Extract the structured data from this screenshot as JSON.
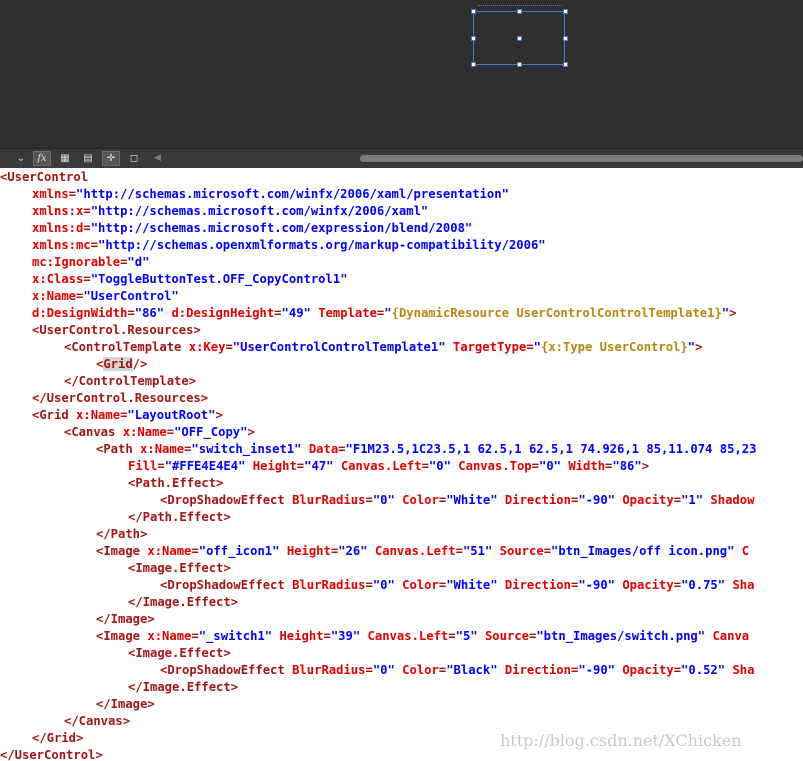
{
  "artboard": {
    "label": "design surface"
  },
  "toolbar": {
    "buttons": [
      {
        "name": "collapse",
        "glyph": "⌄"
      },
      {
        "name": "fx",
        "glyph": "fx"
      },
      {
        "name": "grid",
        "glyph": "▦"
      },
      {
        "name": "table",
        "glyph": "▤"
      },
      {
        "name": "snap",
        "glyph": "✛"
      },
      {
        "name": "annotation",
        "glyph": "◻"
      }
    ],
    "scroll_left": "◀"
  },
  "code": {
    "lines": [
      {
        "indent": 0,
        "tokens": [
          {
            "t": "<UserControl",
            "c": "t"
          }
        ]
      },
      {
        "indent": 1,
        "tokens": [
          {
            "t": "xmlns",
            "c": "a"
          },
          {
            "t": "=",
            "c": "t"
          },
          {
            "t": "\"http://schemas.microsoft.com/winfx/2006/xaml/presentation\"",
            "c": "v"
          }
        ]
      },
      {
        "indent": 1,
        "tokens": [
          {
            "t": "xmlns:x",
            "c": "a"
          },
          {
            "t": "=",
            "c": "t"
          },
          {
            "t": "\"http://schemas.microsoft.com/winfx/2006/xaml\"",
            "c": "v"
          }
        ]
      },
      {
        "indent": 1,
        "tokens": [
          {
            "t": "xmlns:d",
            "c": "a"
          },
          {
            "t": "=",
            "c": "t"
          },
          {
            "t": "\"http://schemas.microsoft.com/expression/blend/2008\"",
            "c": "v"
          }
        ]
      },
      {
        "indent": 1,
        "tokens": [
          {
            "t": "xmlns:mc",
            "c": "a"
          },
          {
            "t": "=",
            "c": "t"
          },
          {
            "t": "\"http://schemas.openxmlformats.org/markup-compatibility/2006\"",
            "c": "v"
          }
        ]
      },
      {
        "indent": 1,
        "tokens": [
          {
            "t": "mc:Ignorable",
            "c": "a"
          },
          {
            "t": "=",
            "c": "t"
          },
          {
            "t": "\"d\"",
            "c": "v"
          }
        ]
      },
      {
        "indent": 1,
        "tokens": [
          {
            "t": "x:Class",
            "c": "a"
          },
          {
            "t": "=",
            "c": "t"
          },
          {
            "t": "\"ToggleButtonTest.OFF_CopyControl1\"",
            "c": "v"
          }
        ]
      },
      {
        "indent": 1,
        "tokens": [
          {
            "t": "x:Name",
            "c": "a"
          },
          {
            "t": "=",
            "c": "t"
          },
          {
            "t": "\"UserControl\"",
            "c": "v"
          }
        ]
      },
      {
        "indent": 1,
        "tokens": [
          {
            "t": "d:DesignWidth",
            "c": "a"
          },
          {
            "t": "=",
            "c": "t"
          },
          {
            "t": "\"86\"",
            "c": "v"
          },
          {
            "t": " ",
            "c": "t"
          },
          {
            "t": "d:DesignHeight",
            "c": "a"
          },
          {
            "t": "=",
            "c": "t"
          },
          {
            "t": "\"49\"",
            "c": "v"
          },
          {
            "t": " ",
            "c": "t"
          },
          {
            "t": "Template",
            "c": "a"
          },
          {
            "t": "=",
            "c": "t"
          },
          {
            "t": "\"",
            "c": "v"
          },
          {
            "t": "{DynamicResource UserControlControlTemplate1}",
            "c": "b"
          },
          {
            "t": "\"",
            "c": "v"
          },
          {
            "t": ">",
            "c": "t"
          }
        ]
      },
      {
        "indent": 1,
        "tokens": [
          {
            "t": "<UserControl.Resources>",
            "c": "t"
          }
        ]
      },
      {
        "indent": 2,
        "tokens": [
          {
            "t": "<ControlTemplate",
            "c": "t"
          },
          {
            "t": " ",
            "c": "t"
          },
          {
            "t": "x:Key",
            "c": "a"
          },
          {
            "t": "=",
            "c": "t"
          },
          {
            "t": "\"UserControlControlTemplate1\"",
            "c": "v"
          },
          {
            "t": " ",
            "c": "t"
          },
          {
            "t": "TargetType",
            "c": "a"
          },
          {
            "t": "=",
            "c": "t"
          },
          {
            "t": "\"",
            "c": "v"
          },
          {
            "t": "{x:Type UserControl}",
            "c": "b"
          },
          {
            "t": "\"",
            "c": "v"
          },
          {
            "t": ">",
            "c": "t"
          }
        ]
      },
      {
        "indent": 3,
        "tokens": [
          {
            "t": "<",
            "c": "t"
          },
          {
            "t": "Grid",
            "c": "h"
          },
          {
            "t": "/>",
            "c": "t"
          }
        ]
      },
      {
        "indent": 2,
        "tokens": [
          {
            "t": "</ControlTemplate>",
            "c": "t"
          }
        ]
      },
      {
        "indent": 1,
        "tokens": [
          {
            "t": "</UserControl.Resources>",
            "c": "t"
          }
        ]
      },
      {
        "indent": 1,
        "tokens": [
          {
            "t": "<Grid",
            "c": "t"
          },
          {
            "t": " ",
            "c": "t"
          },
          {
            "t": "x:Name",
            "c": "a"
          },
          {
            "t": "=",
            "c": "t"
          },
          {
            "t": "\"LayoutRoot\"",
            "c": "v"
          },
          {
            "t": ">",
            "c": "t"
          }
        ]
      },
      {
        "indent": 2,
        "tokens": [
          {
            "t": "<Canvas",
            "c": "t"
          },
          {
            "t": " ",
            "c": "t"
          },
          {
            "t": "x:Name",
            "c": "a"
          },
          {
            "t": "=",
            "c": "t"
          },
          {
            "t": "\"OFF_Copy\"",
            "c": "v"
          },
          {
            "t": ">",
            "c": "t"
          }
        ]
      },
      {
        "indent": 3,
        "tokens": [
          {
            "t": "<Path",
            "c": "t"
          },
          {
            "t": " ",
            "c": "t"
          },
          {
            "t": "x:Name",
            "c": "a"
          },
          {
            "t": "=",
            "c": "t"
          },
          {
            "t": "\"switch_inset1\"",
            "c": "v"
          },
          {
            "t": " ",
            "c": "t"
          },
          {
            "t": "Data",
            "c": "a"
          },
          {
            "t": "=",
            "c": "t"
          },
          {
            "t": "\"F1M23.5,1C23.5,1 62.5,1 62.5,1 74.926,1 85,11.074 85,23",
            "c": "v"
          }
        ]
      },
      {
        "indent": 4,
        "tokens": [
          {
            "t": "Fill",
            "c": "a"
          },
          {
            "t": "=",
            "c": "t"
          },
          {
            "t": "\"#FFE4E4E4\"",
            "c": "v"
          },
          {
            "t": " ",
            "c": "t"
          },
          {
            "t": "Height",
            "c": "a"
          },
          {
            "t": "=",
            "c": "t"
          },
          {
            "t": "\"47\"",
            "c": "v"
          },
          {
            "t": " ",
            "c": "t"
          },
          {
            "t": "Canvas.Left",
            "c": "a"
          },
          {
            "t": "=",
            "c": "t"
          },
          {
            "t": "\"0\"",
            "c": "v"
          },
          {
            "t": " ",
            "c": "t"
          },
          {
            "t": "Canvas.Top",
            "c": "a"
          },
          {
            "t": "=",
            "c": "t"
          },
          {
            "t": "\"0\"",
            "c": "v"
          },
          {
            "t": " ",
            "c": "t"
          },
          {
            "t": "Width",
            "c": "a"
          },
          {
            "t": "=",
            "c": "t"
          },
          {
            "t": "\"86\"",
            "c": "v"
          },
          {
            "t": ">",
            "c": "t"
          }
        ]
      },
      {
        "indent": 4,
        "tokens": [
          {
            "t": "<Path.Effect>",
            "c": "t"
          }
        ]
      },
      {
        "indent": 5,
        "tokens": [
          {
            "t": "<DropShadowEffect",
            "c": "t"
          },
          {
            "t": " ",
            "c": "t"
          },
          {
            "t": "BlurRadius",
            "c": "a"
          },
          {
            "t": "=",
            "c": "t"
          },
          {
            "t": "\"0\"",
            "c": "v"
          },
          {
            "t": " ",
            "c": "t"
          },
          {
            "t": "Color",
            "c": "a"
          },
          {
            "t": "=",
            "c": "t"
          },
          {
            "t": "\"White\"",
            "c": "v"
          },
          {
            "t": " ",
            "c": "t"
          },
          {
            "t": "Direction",
            "c": "a"
          },
          {
            "t": "=",
            "c": "t"
          },
          {
            "t": "\"-90\"",
            "c": "v"
          },
          {
            "t": " ",
            "c": "t"
          },
          {
            "t": "Opacity",
            "c": "a"
          },
          {
            "t": "=",
            "c": "t"
          },
          {
            "t": "\"1\"",
            "c": "v"
          },
          {
            "t": " ",
            "c": "t"
          },
          {
            "t": "Shadow",
            "c": "a"
          }
        ]
      },
      {
        "indent": 4,
        "tokens": [
          {
            "t": "</Path.Effect>",
            "c": "t"
          }
        ]
      },
      {
        "indent": 3,
        "tokens": [
          {
            "t": "</Path>",
            "c": "t"
          }
        ]
      },
      {
        "indent": 3,
        "tokens": [
          {
            "t": "<Image",
            "c": "t"
          },
          {
            "t": " ",
            "c": "t"
          },
          {
            "t": "x:Name",
            "c": "a"
          },
          {
            "t": "=",
            "c": "t"
          },
          {
            "t": "\"off_icon1\"",
            "c": "v"
          },
          {
            "t": " ",
            "c": "t"
          },
          {
            "t": "Height",
            "c": "a"
          },
          {
            "t": "=",
            "c": "t"
          },
          {
            "t": "\"26\"",
            "c": "v"
          },
          {
            "t": " ",
            "c": "t"
          },
          {
            "t": "Canvas.Left",
            "c": "a"
          },
          {
            "t": "=",
            "c": "t"
          },
          {
            "t": "\"51\"",
            "c": "v"
          },
          {
            "t": " ",
            "c": "t"
          },
          {
            "t": "Source",
            "c": "a"
          },
          {
            "t": "=",
            "c": "t"
          },
          {
            "t": "\"btn_Images/off icon.png\"",
            "c": "v"
          },
          {
            "t": " C",
            "c": "a"
          }
        ]
      },
      {
        "indent": 4,
        "tokens": [
          {
            "t": "<Image.Effect>",
            "c": "t"
          }
        ]
      },
      {
        "indent": 5,
        "tokens": [
          {
            "t": "<DropShadowEffect",
            "c": "t"
          },
          {
            "t": " ",
            "c": "t"
          },
          {
            "t": "BlurRadius",
            "c": "a"
          },
          {
            "t": "=",
            "c": "t"
          },
          {
            "t": "\"0\"",
            "c": "v"
          },
          {
            "t": " ",
            "c": "t"
          },
          {
            "t": "Color",
            "c": "a"
          },
          {
            "t": "=",
            "c": "t"
          },
          {
            "t": "\"White\"",
            "c": "v"
          },
          {
            "t": " ",
            "c": "t"
          },
          {
            "t": "Direction",
            "c": "a"
          },
          {
            "t": "=",
            "c": "t"
          },
          {
            "t": "\"-90\"",
            "c": "v"
          },
          {
            "t": " ",
            "c": "t"
          },
          {
            "t": "Opacity",
            "c": "a"
          },
          {
            "t": "=",
            "c": "t"
          },
          {
            "t": "\"0.75\"",
            "c": "v"
          },
          {
            "t": " ",
            "c": "t"
          },
          {
            "t": "Sha",
            "c": "a"
          }
        ]
      },
      {
        "indent": 4,
        "tokens": [
          {
            "t": "</Image.Effect>",
            "c": "t"
          }
        ]
      },
      {
        "indent": 3,
        "tokens": [
          {
            "t": "</Image>",
            "c": "t"
          }
        ]
      },
      {
        "indent": 3,
        "tokens": [
          {
            "t": "<Image",
            "c": "t"
          },
          {
            "t": " ",
            "c": "t"
          },
          {
            "t": "x:Name",
            "c": "a"
          },
          {
            "t": "=",
            "c": "t"
          },
          {
            "t": "\"_switch1\"",
            "c": "v"
          },
          {
            "t": " ",
            "c": "t"
          },
          {
            "t": "Height",
            "c": "a"
          },
          {
            "t": "=",
            "c": "t"
          },
          {
            "t": "\"39\"",
            "c": "v"
          },
          {
            "t": " ",
            "c": "t"
          },
          {
            "t": "Canvas.Left",
            "c": "a"
          },
          {
            "t": "=",
            "c": "t"
          },
          {
            "t": "\"5\"",
            "c": "v"
          },
          {
            "t": " ",
            "c": "t"
          },
          {
            "t": "Source",
            "c": "a"
          },
          {
            "t": "=",
            "c": "t"
          },
          {
            "t": "\"btn_Images/switch.png\"",
            "c": "v"
          },
          {
            "t": " Canva",
            "c": "a"
          }
        ]
      },
      {
        "indent": 4,
        "tokens": [
          {
            "t": "<Image.Effect>",
            "c": "t"
          }
        ]
      },
      {
        "indent": 5,
        "tokens": [
          {
            "t": "<DropShadowEffect",
            "c": "t"
          },
          {
            "t": " ",
            "c": "t"
          },
          {
            "t": "BlurRadius",
            "c": "a"
          },
          {
            "t": "=",
            "c": "t"
          },
          {
            "t": "\"0\"",
            "c": "v"
          },
          {
            "t": " ",
            "c": "t"
          },
          {
            "t": "Color",
            "c": "a"
          },
          {
            "t": "=",
            "c": "t"
          },
          {
            "t": "\"Black\"",
            "c": "v"
          },
          {
            "t": " ",
            "c": "t"
          },
          {
            "t": "Direction",
            "c": "a"
          },
          {
            "t": "=",
            "c": "t"
          },
          {
            "t": "\"-90\"",
            "c": "v"
          },
          {
            "t": " ",
            "c": "t"
          },
          {
            "t": "Opacity",
            "c": "a"
          },
          {
            "t": "=",
            "c": "t"
          },
          {
            "t": "\"0.52\"",
            "c": "v"
          },
          {
            "t": " ",
            "c": "t"
          },
          {
            "t": "Sha",
            "c": "a"
          }
        ]
      },
      {
        "indent": 4,
        "tokens": [
          {
            "t": "</Image.Effect>",
            "c": "t"
          }
        ]
      },
      {
        "indent": 3,
        "tokens": [
          {
            "t": "</Image>",
            "c": "t"
          }
        ]
      },
      {
        "indent": 2,
        "tokens": [
          {
            "t": "</Canvas>",
            "c": "t"
          }
        ]
      },
      {
        "indent": 1,
        "tokens": [
          {
            "t": "</Grid>",
            "c": "t"
          }
        ]
      },
      {
        "indent": 0,
        "tokens": [
          {
            "t": "</UserControl>",
            "c": "t"
          }
        ]
      }
    ]
  },
  "watermark": "http://blog.csdn.net/XChicken",
  "colors": {
    "tag": "#a31515",
    "attribute": "#e30000",
    "value": "#0000ff",
    "binding": "#b8860b",
    "artboard": "#2f2f2f",
    "selection": "#4a78c8"
  }
}
